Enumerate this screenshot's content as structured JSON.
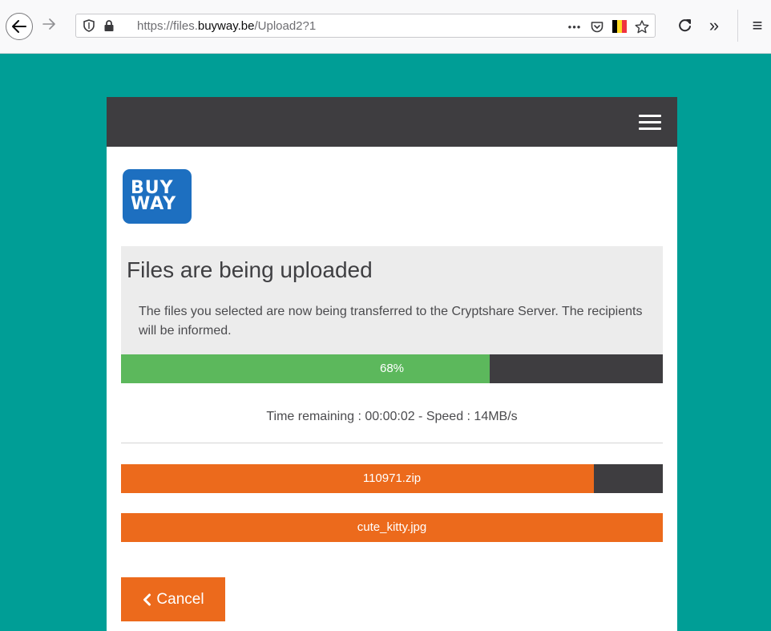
{
  "browser": {
    "url_scheme": "https://files.",
    "url_host": "buyway.be",
    "url_path": "/Upload2?1",
    "more_label": "•••",
    "overflow_label": "»",
    "menu_label": "≡",
    "flag_colors": [
      "#000000",
      "#fdda24",
      "#ef3340"
    ]
  },
  "logo": {
    "line1": "BUY",
    "line2": "WAY",
    "color": "#1d6fc0"
  },
  "upload": {
    "title": "Files are being uploaded",
    "description": "The files you selected are now being transferred to the Cryptshare Server. The recipients will be informed.",
    "progress_label": "68%",
    "progress_fraction": 0.68,
    "time_remaining": "Time remaining : 00:00:02 -  Speed : 14MB/s"
  },
  "files": [
    {
      "name": "110971.zip",
      "progress_fraction": 0.873
    },
    {
      "name": "cute_kitty.jpg",
      "progress_fraction": 1.0
    }
  ],
  "cancel": {
    "icon": "chevron-left-icon",
    "label": "Cancel"
  },
  "colors": {
    "page_bg": "#009e96",
    "header_bg": "#3e3d40",
    "progress_green": "#5cb85c",
    "file_orange": "#ec6a1c"
  }
}
